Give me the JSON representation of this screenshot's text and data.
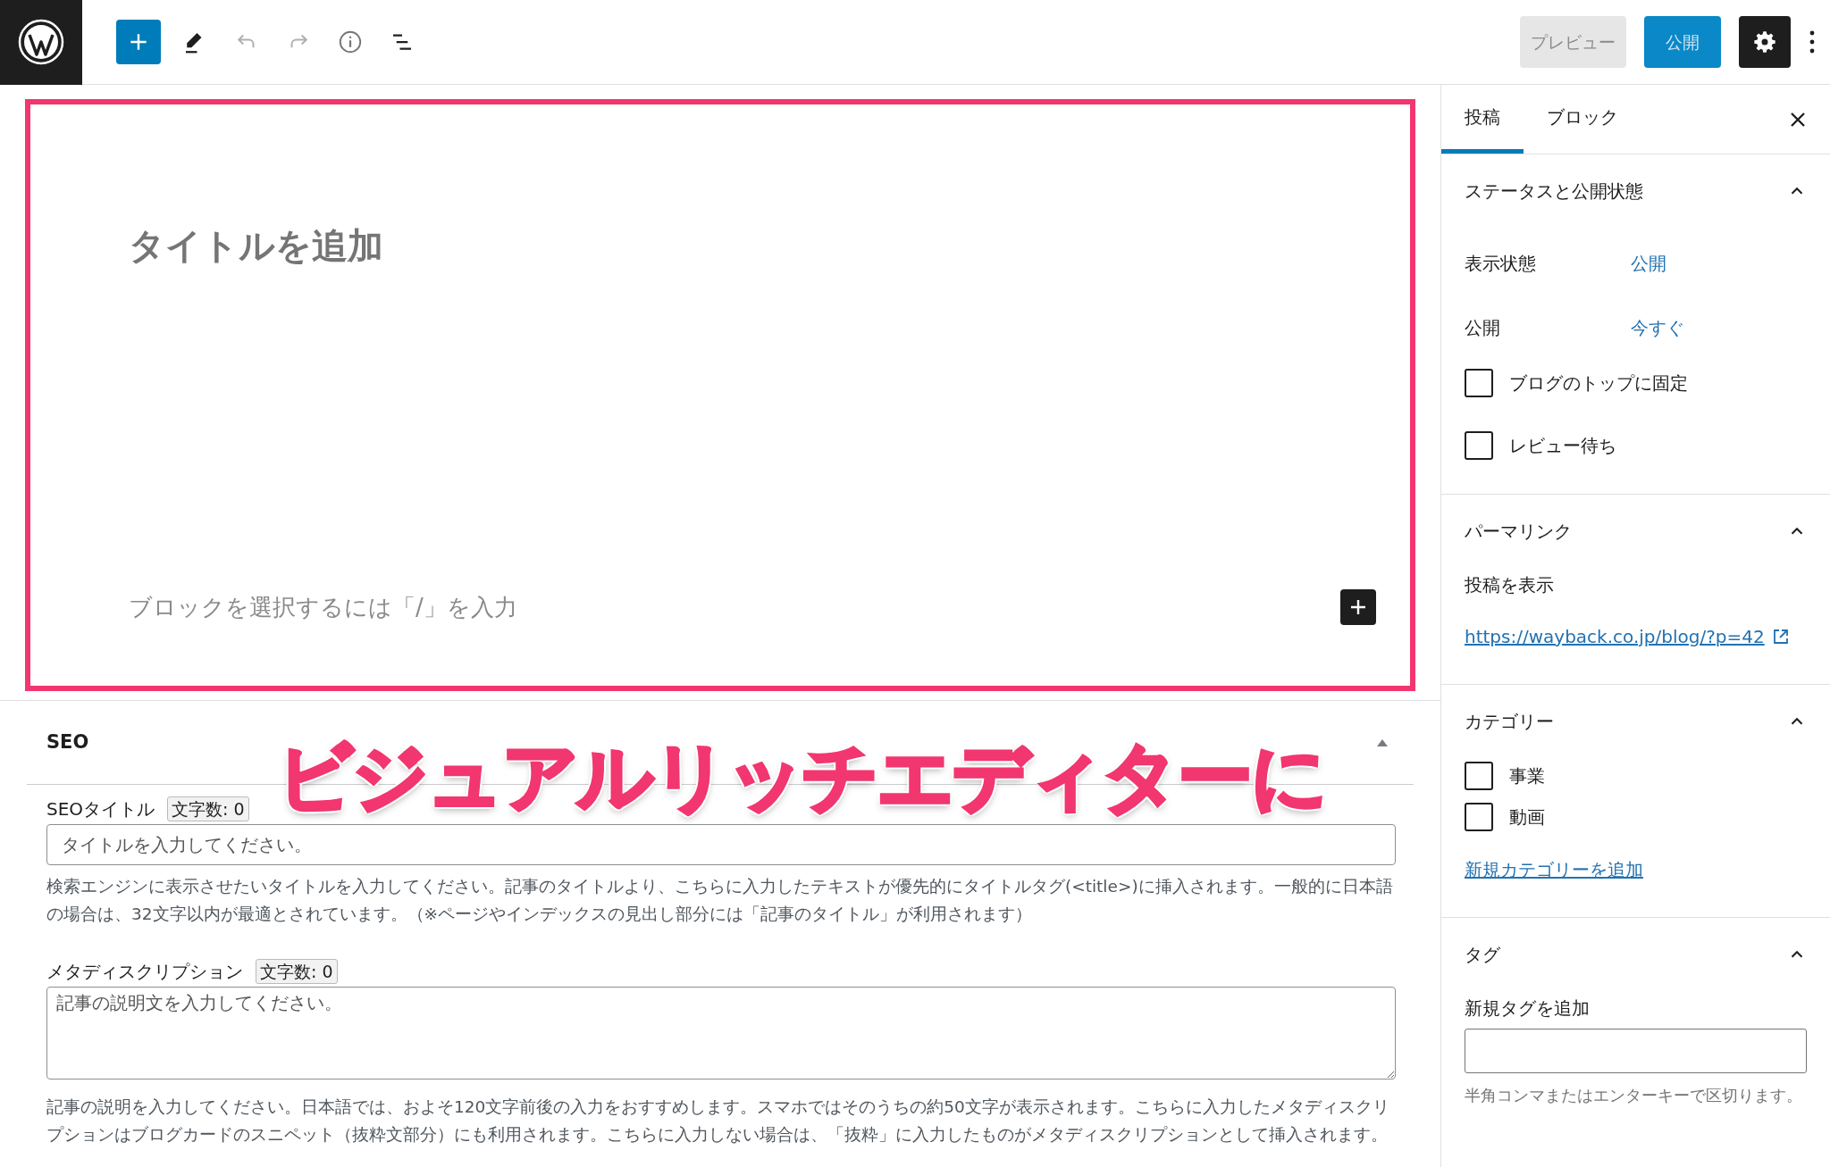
{
  "toolbar": {
    "left": [
      {
        "kind": "add",
        "disabled": false
      },
      {
        "kind": "edit",
        "disabled": false
      },
      {
        "kind": "undo",
        "disabled": true
      },
      {
        "kind": "redo",
        "disabled": true
      },
      {
        "kind": "info",
        "disabled": false
      },
      {
        "kind": "list",
        "disabled": false
      }
    ],
    "preview_button": "プレビュー",
    "publish_button": "公開",
    "settings_pressed": true
  },
  "editor": {
    "title_placeholder": "タイトルを追加",
    "block_placeholder": "ブロックを選択するには「/」を入力",
    "highlighted": true
  },
  "annotation": {
    "text": "ビジュアルリッチエディターに"
  },
  "seo": {
    "heading": "SEO",
    "expanded": true,
    "fields": [
      {
        "kind": "input",
        "label": "SEOタイトル",
        "count": "文字数: 0",
        "placeholder": "タイトルを入力してください。",
        "help": "検索エンジンに表示させたいタイトルを入力してください。記事のタイトルより、こちらに入力したテキストが優先的にタイトルタグ(<title>)に挿入されます。一般的に日本語の場合は、32文字以内が最適とされています。（※ページやインデックスの見出し部分には「記事のタイトル」が利用されます）"
      },
      {
        "kind": "textarea",
        "label": "メタディスクリプション",
        "count": "文字数: 0",
        "placeholder": "記事の説明文を入力してください。",
        "help": "記事の説明を入力してください。日本語では、およそ120文字前後の入力をおすすめします。スマホではそのうちの約50文字が表示されます。こちらに入力したメタディスクリプションはブログカードのスニペット（抜粋文部分）にも利用されます。こちらに入力しない場合は、「抜粋」に入力したものがメタディスクリプションとして挿入されます。"
      }
    ]
  },
  "sidebar": {
    "tabs": [
      {
        "label": "投稿",
        "selected": true
      },
      {
        "label": "ブロック",
        "selected": false
      }
    ],
    "status": {
      "heading": "ステータスと公開状態",
      "expanded": true,
      "rows": [
        {
          "label": "表示状態",
          "value": "公開"
        },
        {
          "label": "公開",
          "value": "今すぐ"
        }
      ],
      "checkboxes": [
        {
          "label": "ブログのトップに固定",
          "checked": false
        },
        {
          "label": "レビュー待ち",
          "checked": false
        }
      ]
    },
    "permalink": {
      "heading": "パーマリンク",
      "expanded": true,
      "label": "投稿を表示",
      "url": "https://wayback.co.jp/blog/?p=42"
    },
    "categories": {
      "heading": "カテゴリー",
      "expanded": true,
      "items": [
        {
          "label": "事業",
          "checked": false
        },
        {
          "label": "動画",
          "checked": false
        }
      ],
      "add_link": "新規カテゴリーを追加"
    },
    "tags": {
      "heading": "タグ",
      "expanded": true,
      "label": "新規タグを追加",
      "help": "半角コンマまたはエンターキーで区切ります。"
    }
  }
}
